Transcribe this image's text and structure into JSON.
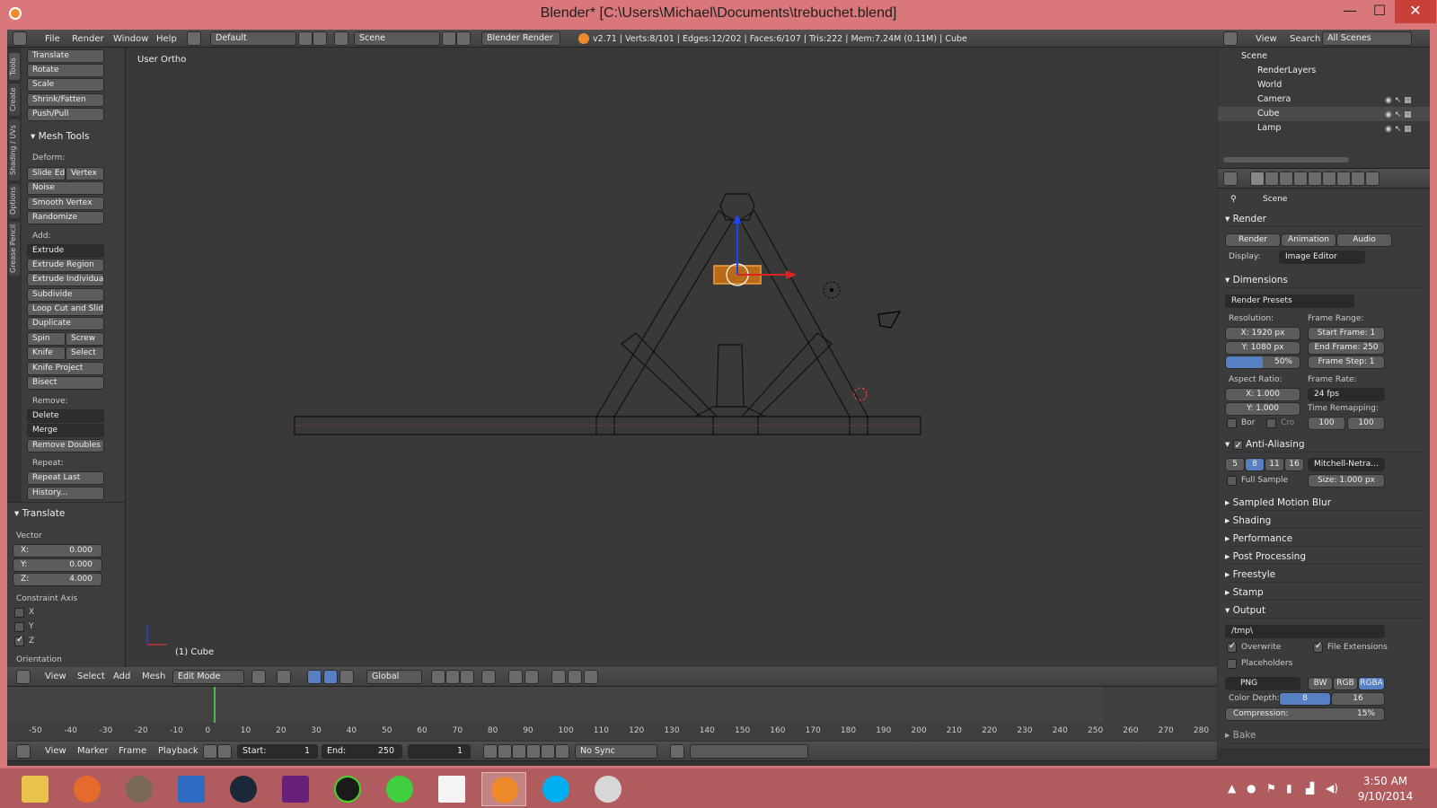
{
  "window": {
    "title": "Blender* [C:\\Users\\Michael\\Documents\\trebuchet.blend]",
    "minimize": "—",
    "maximize": "☐",
    "close": "✕"
  },
  "info": {
    "menus": [
      "File",
      "Render",
      "Window",
      "Help"
    ],
    "layout": "Default",
    "scene": "Scene",
    "engine": "Blender Render",
    "stats": "v2.71 | Verts:8/101 | Edges:12/202 | Faces:6/107 | Tris:222 | Mem:7.24M (0.11M) | Cube"
  },
  "toolshelf": {
    "tabs": [
      "Tools",
      "Create",
      "Shading / UVs",
      "Options",
      "Grease Pencil"
    ],
    "transform": [
      "Translate",
      "Rotate",
      "Scale",
      "Shrink/Fatten",
      "Push/Pull"
    ],
    "mesh_tools_label": "Mesh Tools",
    "deform_label": "Deform:",
    "slide_edge": "Slide Ed",
    "vertex": "Vertex",
    "deform": [
      "Noise",
      "Smooth Vertex",
      "Randomize"
    ],
    "add_label": "Add:",
    "extrude": "Extrude",
    "add": [
      "Extrude Region",
      "Extrude Individual",
      "Subdivide",
      "Loop Cut and Slide",
      "Duplicate"
    ],
    "spin": "Spin",
    "screw": "Screw",
    "knife": "Knife",
    "select": "Select",
    "add2": [
      "Knife Project",
      "Bisect"
    ],
    "remove_label": "Remove:",
    "delete": "Delete",
    "merge": "Merge",
    "remove_doubles": "Remove Doubles",
    "repeat_label": "Repeat:",
    "repeat_last": "Repeat Last",
    "history": "History...",
    "op_title": "Translate",
    "vector_label": "Vector",
    "vx": "X:",
    "vx_val": "0.000",
    "vy": "Y:",
    "vy_val": "0.000",
    "vz": "Z:",
    "vz_val": "4.000",
    "constraint_label": "Constraint Axis",
    "cx": "X",
    "cy": "Y",
    "cz": "Z",
    "orientation_label": "Orientation"
  },
  "viewport": {
    "view_name": "User Ortho",
    "object_label": "(1) Cube",
    "menus": [
      "View",
      "Select",
      "Add",
      "Mesh"
    ],
    "mode": "Edit Mode",
    "orientation": "Global"
  },
  "timeline": {
    "ticks": [
      "-50",
      "-40",
      "-30",
      "-20",
      "-10",
      "0",
      "10",
      "20",
      "30",
      "40",
      "50",
      "60",
      "70",
      "80",
      "90",
      "100",
      "110",
      "120",
      "130",
      "140",
      "150",
      "160",
      "170",
      "180",
      "190",
      "200",
      "210",
      "220",
      "230",
      "240",
      "250",
      "260",
      "270",
      "280"
    ],
    "menus": [
      "View",
      "Marker",
      "Frame",
      "Playback"
    ],
    "start_label": "Start:",
    "start": "1",
    "end_label": "End:",
    "end": "250",
    "current": "1",
    "sync": "No Sync"
  },
  "outliner": {
    "view": "View",
    "search": "Search",
    "scope": "All Scenes",
    "items": [
      "Scene",
      "RenderLayers",
      "World",
      "Camera",
      "Cube",
      "Lamp"
    ]
  },
  "properties": {
    "context": "Scene",
    "render_label": "Render",
    "btn_render": "Render",
    "btn_animation": "Animation",
    "btn_audio": "Audio",
    "display_label": "Display:",
    "display": "Image Editor",
    "dimensions": "Dimensions",
    "presets": "Render Presets",
    "resolution_label": "Resolution:",
    "res_x": "X:",
    "res_x_val": "1920 px",
    "res_y": "Y:",
    "res_y_val": "1080 px",
    "res_pct": "50%",
    "frame_range_label": "Frame Range:",
    "start_frame": "Start Frame: 1",
    "end_frame": "End Frame: 250",
    "frame_step": "Frame Step: 1",
    "aspect_label": "Aspect Ratio:",
    "asp_x": "X:",
    "asp_x_val": "1.000",
    "asp_y": "Y:",
    "asp_y_val": "1.000",
    "frame_rate_label": "Frame Rate:",
    "fps": "24 fps",
    "remap_label": "Time Remapping:",
    "remap_old": "100",
    "remap_new": "100",
    "bor": "Bor",
    "cro": "Cro",
    "aa": "Anti-Aliasing",
    "aa_samples": [
      "5",
      "8",
      "11",
      "16"
    ],
    "filter": "Mitchell-Netra...",
    "full_sample": "Full Sample",
    "size": "Size: 1.000 px",
    "sections": [
      "Sampled Motion Blur",
      "Shading",
      "Performance",
      "Post Processing",
      "Freestyle",
      "Stamp"
    ],
    "output": "Output",
    "path": "/tmp\\",
    "overwrite": "Overwrite",
    "file_ext": "File Extensions",
    "placeholders": "Placeholders",
    "format": "PNG",
    "bw": "BW",
    "rgb": "RGB",
    "rgba": "RGBA",
    "color_depth_label": "Color Depth:",
    "depth_8": "8",
    "depth_16": "16",
    "compression": "Compression:",
    "compression_val": "15%",
    "bake": "Bake"
  },
  "taskbar": {
    "time": "3:50 AM",
    "date": "9/10/2014"
  },
  "colors": {
    "titlebar": "#d9777a",
    "taskbar": "#b05b5e",
    "selected": "#f0a040",
    "panel": "#3d3d3d"
  }
}
